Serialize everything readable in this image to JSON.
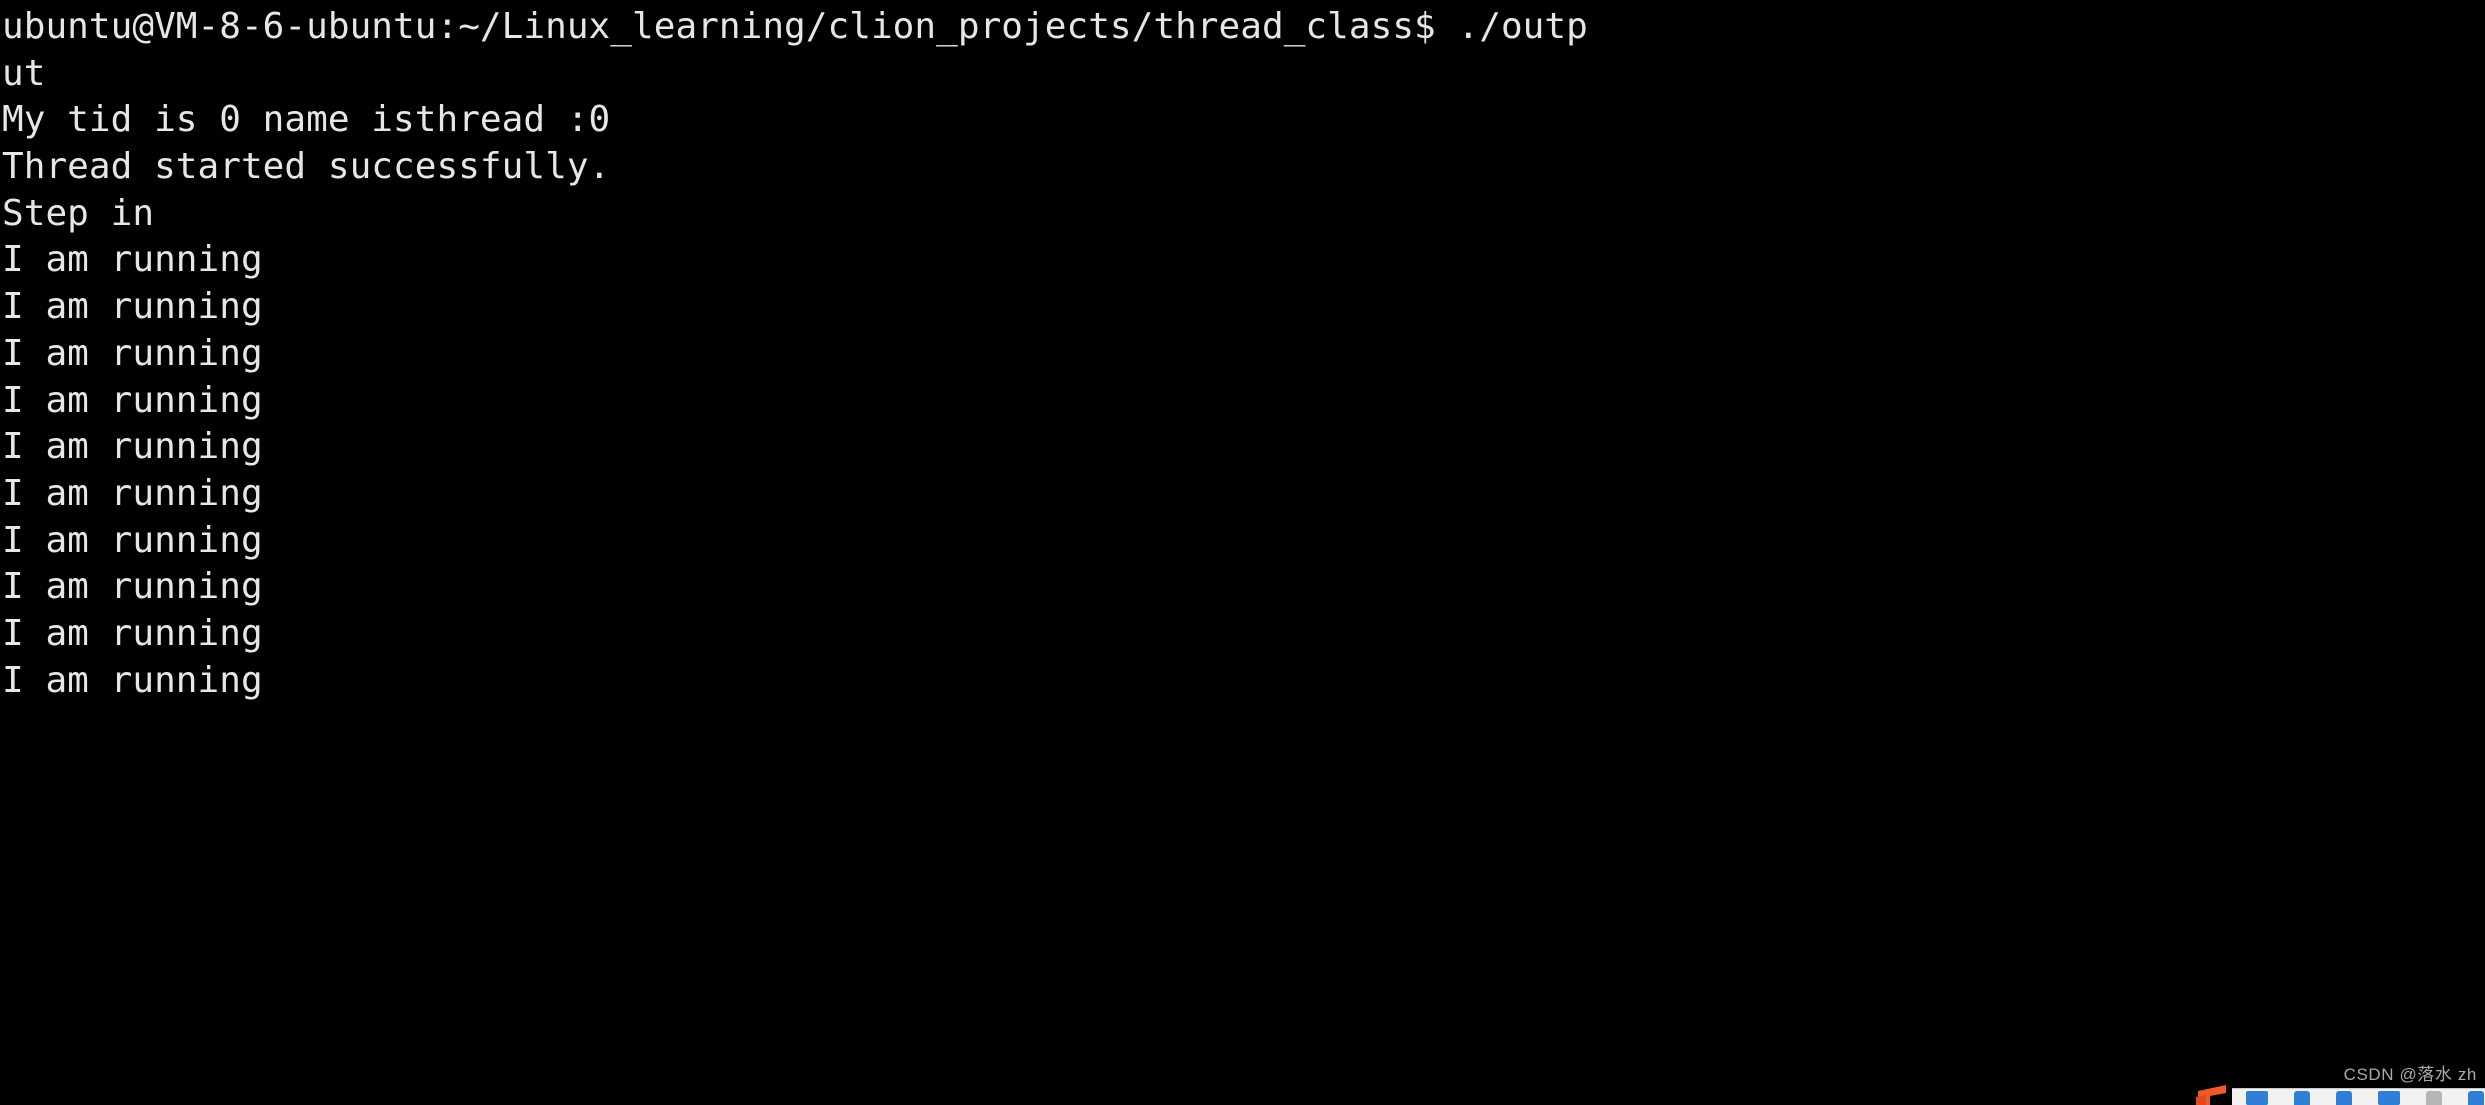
{
  "terminal": {
    "background_color": "#000000",
    "foreground_color": "#e8e6e3",
    "prompt_user_host": "ubuntu@VM-8-6-ubuntu",
    "prompt_path": "~/Linux_learning/clion_projects/thread_class",
    "prompt_symbol": "$",
    "command": "./output",
    "lines": [
      "ubuntu@VM-8-6-ubuntu:~/Linux_learning/clion_projects/thread_class$ ./outp",
      "ut",
      "My tid is 0 name isthread :0",
      "Thread started successfully.",
      "Step in",
      "I am running",
      "I am running",
      "I am running",
      "I am running",
      "I am running",
      "I am running",
      "I am running",
      "I am running",
      "I am running",
      "I am running"
    ]
  },
  "overlay": {
    "watermark": "CSDN @落水 zh",
    "watermark_color": "#b9b9b9",
    "taskbar_background": "#f2f2f2",
    "app_icon_color": "#f05a28",
    "taskbar_icon_color": "#2f7fd8"
  }
}
